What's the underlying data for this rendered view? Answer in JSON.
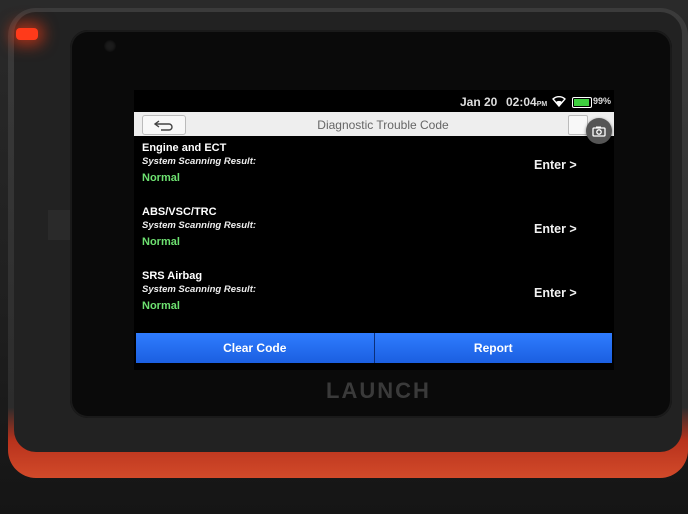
{
  "device": {
    "brand": "LAUNCH"
  },
  "statusbar": {
    "date": "Jan 20",
    "time": "02:04",
    "ampm": "PM",
    "battery": "99%"
  },
  "header": {
    "title": "Diagnostic Trouble Code"
  },
  "systems": [
    {
      "name": "Engine and ECT",
      "subtitle": "System Scanning Result:",
      "status": "Normal",
      "enter": "Enter >"
    },
    {
      "name": "ABS/VSC/TRC",
      "subtitle": "System Scanning Result:",
      "status": "Normal",
      "enter": "Enter >"
    },
    {
      "name": "SRS Airbag",
      "subtitle": "System Scanning Result:",
      "status": "Normal",
      "enter": "Enter >"
    }
  ],
  "footer": {
    "clear_code": "Clear Code",
    "report": "Report"
  },
  "colors": {
    "accent": "#1b5fe0",
    "status_ok": "#6de070",
    "led": "#ff3a1a"
  },
  "icons": {
    "back": "back-arrow-icon",
    "camera": "camera-icon",
    "wifi": "wifi-icon",
    "battery": "battery-icon"
  }
}
